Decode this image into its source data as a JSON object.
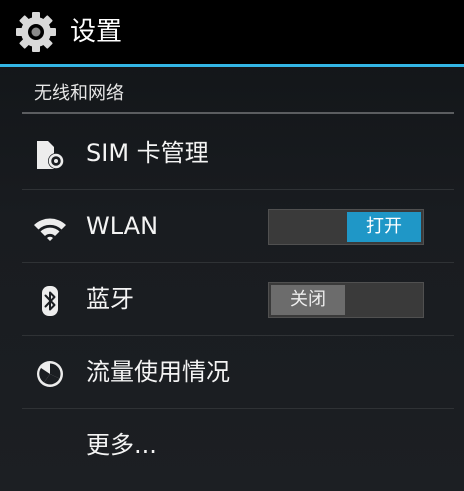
{
  "action_bar": {
    "title": "设置",
    "icon": "gear-icon"
  },
  "section": {
    "title": "无线和网络"
  },
  "rows": [
    {
      "label": "SIM 卡管理",
      "icon": "sim-card-icon"
    },
    {
      "label": "WLAN",
      "icon": "wifi-icon",
      "switch_state": "on",
      "switch_label": "打开"
    },
    {
      "label": "蓝牙",
      "icon": "bluetooth-icon",
      "switch_state": "off",
      "switch_label": "关闭"
    },
    {
      "label": "流量使用情况",
      "icon": "data-usage-icon"
    },
    {
      "label": "更多..."
    }
  ],
  "colors": {
    "accent": "#33b5e5",
    "switch_on": "#1f97c7",
    "switch_off": "#6c6c6c"
  }
}
